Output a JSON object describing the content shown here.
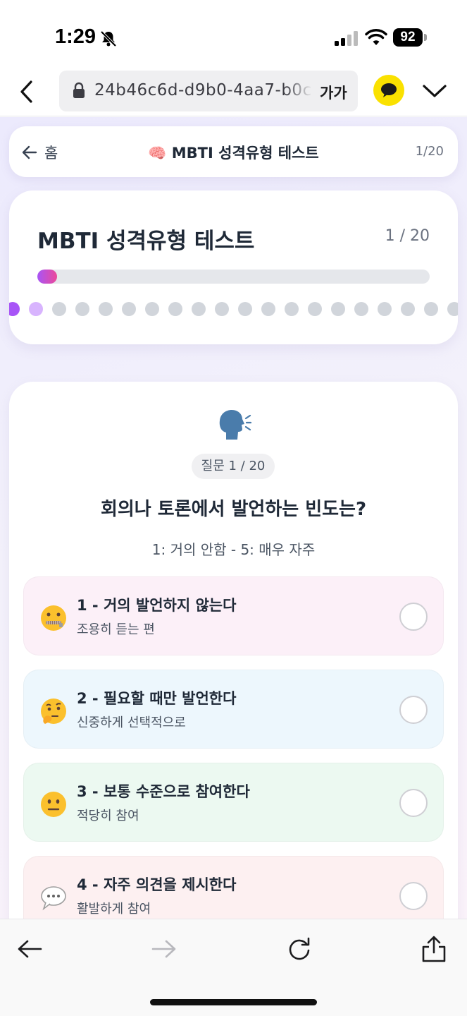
{
  "status_bar": {
    "time": "1:29",
    "battery": "92"
  },
  "browser": {
    "url": "24b46c6d-d9b0-4aa7-b0c",
    "text_size_label": "가가"
  },
  "nav": {
    "home_label": "홈",
    "title": "🧠 MBTI 성격유형 테스트",
    "progress": "1/20"
  },
  "progress_card": {
    "title": "MBTI 성격유형 테스트",
    "count": "1 / 20",
    "progress_fraction": 0.05,
    "total_questions": 20,
    "current_question": 1,
    "color_done": "#a855f7",
    "color_next": "#d8b4fe",
    "color_pending": "#d1d5db"
  },
  "question": {
    "icon": "speaking-head-icon",
    "badge": "질문 1 / 20",
    "text": "회의나 토론에서 발언하는 빈도는?",
    "scale_hint": "1: 거의 안함 - 5: 매우 자주"
  },
  "options": [
    {
      "title": "1 - 거의 발언하지 않는다",
      "desc": "조용히 듣는 편",
      "icon": "zipper-mouth-face-icon",
      "bg": "#fcf0f8"
    },
    {
      "title": "2 - 필요할 때만 발언한다",
      "desc": "신중하게 선택적으로",
      "icon": "thinking-face-icon",
      "bg": "#edf7fd"
    },
    {
      "title": "3 - 보통 수준으로 참여한다",
      "desc": "적당히 참여",
      "icon": "neutral-face-icon",
      "bg": "#ecf9f1"
    },
    {
      "title": "4 - 자주 의견을 제시한다",
      "desc": "활발하게 참여",
      "icon": "speech-balloon-icon",
      "bg": "#fdf0f1"
    }
  ]
}
